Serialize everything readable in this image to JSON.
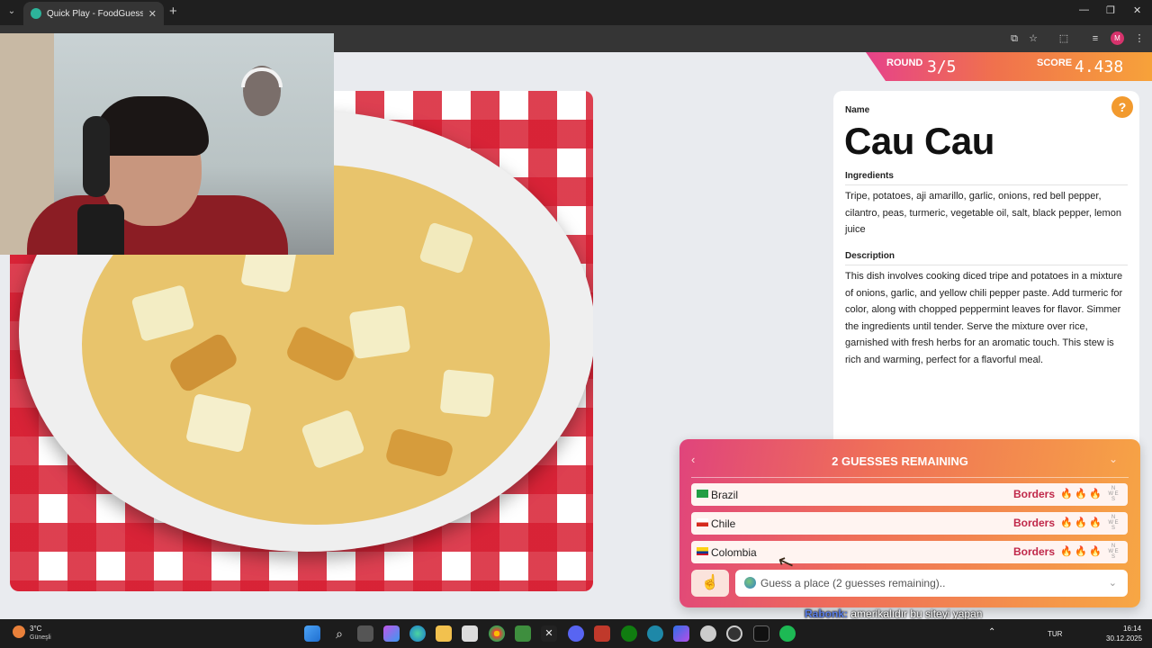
{
  "browser": {
    "tab_title": "Quick Play - FoodGuessr | Food",
    "tab_close": "✕",
    "new_tab": "+",
    "profile_initial": "M"
  },
  "game": {
    "round_label": "ROUND",
    "round_value": "3/5",
    "score_label": "SCORE",
    "score_value": "4.438"
  },
  "dish": {
    "name_label": "Name",
    "name": "Cau Cau",
    "ingredients_label": "Ingredients",
    "ingredients": "Tripe, potatoes, aji amarillo, garlic, onions, red bell pepper, cilantro, peas, turmeric, vegetable oil, salt, black pepper, lemon juice",
    "description_label": "Description",
    "description": "This dish involves cooking diced tripe and potatoes in a mixture of onions, garlic, and yellow chili pepper paste. Add turmeric for color, along with chopped peppermint leaves for flavor. Simmer the ingredients until tender. Serve the mixture over rice, garnished with fresh herbs for an aromatic touch. This stew is rich and warming, perfect for a flavorful meal.",
    "help_icon": "?"
  },
  "guesses": {
    "title": "2 GUESSES REMAINING",
    "rows": [
      {
        "country": "Brazil",
        "result": "Borders",
        "flag_colors": [
          "#229e45",
          "#f8e509"
        ]
      },
      {
        "country": "Chile",
        "result": "Borders",
        "flag_colors": [
          "#ffffff",
          "#d52b1e"
        ]
      },
      {
        "country": "Colombia",
        "result": "Borders",
        "flag_colors": [
          "#fcd116",
          "#003893"
        ]
      }
    ],
    "input_placeholder": "Guess a place (2 guesses remaining).."
  },
  "chat": {
    "user": "Rabonk:",
    "message": "amerikalıdır bu siteyi yapan"
  },
  "taskbar": {
    "weather_temp": "3°C",
    "weather_desc": "Güneşli",
    "language": "TUR",
    "time": "16:14",
    "date": "30.12.2025"
  }
}
